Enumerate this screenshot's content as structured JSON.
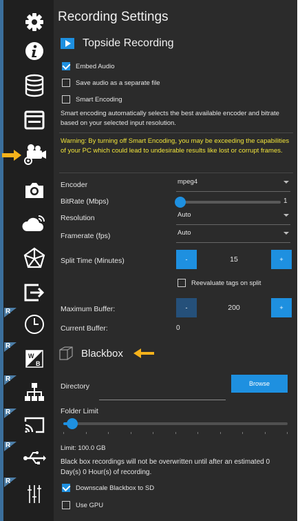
{
  "panel": {
    "title": "Recording Settings",
    "topside": {
      "heading": "Topside Recording",
      "embed_audio": "Embed Audio",
      "save_audio": "Save audio as a separate file",
      "smart_encoding": "Smart Encoding",
      "info": "Smart encoding automatically selects the best available encoder and bitrate based on your selected input resolution.",
      "warning": "Warning: By turning off Smart Encoding, you may be exceeding the capabilities of your PC which could lead to undesirable results like lost or corrupt frames.",
      "encoder_label": "Encoder",
      "encoder_value": "mpeg4",
      "bitrate_label": "BitRate (Mbps)",
      "bitrate_value": "1",
      "bitrate_level": 0.0,
      "resolution_label": "Resolution",
      "resolution_value": "Auto",
      "framerate_label": "Framerate (fps)",
      "framerate_value": "Auto",
      "split_label": "Split Time (Minutes)",
      "split_value": "15",
      "reevaluate": "Reevaluate tags on split",
      "maxbuf_label": "Maximum Buffer:",
      "maxbuf_value": "200",
      "curbuf_label": "Current Buffer:",
      "curbuf_value": "0",
      "minus": "-",
      "plus": "+"
    },
    "blackbox": {
      "heading": "Blackbox",
      "directory_label": "Directory",
      "browse": "Browse",
      "folder_limit_label": "Folder Limit",
      "folder_limit_level": 0.04,
      "limit_text": "Limit: 100.0 GB",
      "overwrite_note": "Black box recordings will not be overwritten until after an estimated 0 Day(s) 0 Hour(s) of recording.",
      "downscale": "Downscale Blackbox to SD",
      "use_gpu": "Use GPU"
    }
  },
  "sidebar": {
    "items": [
      {
        "icon": "gear-icon"
      },
      {
        "icon": "info-icon"
      },
      {
        "icon": "database-icon"
      },
      {
        "icon": "window-icon"
      },
      {
        "icon": "video-camera-gear-icon"
      },
      {
        "icon": "camera-icon"
      },
      {
        "icon": "cloud-wifi-icon"
      },
      {
        "icon": "pentagon-network-icon"
      },
      {
        "icon": "export-icon"
      },
      {
        "icon": "clock-icon",
        "badge": "R"
      },
      {
        "icon": "white-balance-icon",
        "badge": "R"
      },
      {
        "icon": "network-icon",
        "badge": "R"
      },
      {
        "icon": "cast-icon",
        "badge": "R"
      },
      {
        "icon": "usb-icon",
        "badge": "R"
      },
      {
        "icon": "sliders-icon",
        "badge": "R"
      }
    ]
  },
  "colors": {
    "accent": "#1e90e0",
    "warning": "#f1e43b",
    "callout": "#f5b21b"
  }
}
